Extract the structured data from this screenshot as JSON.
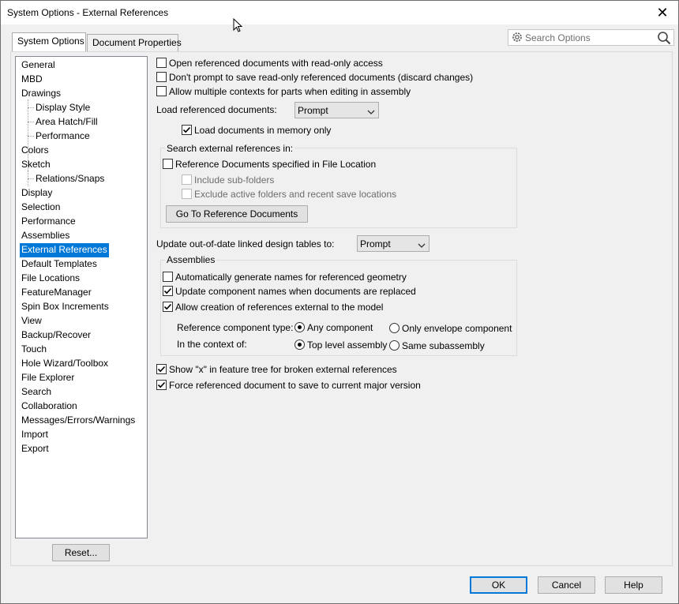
{
  "window": {
    "title": "System Options - External References"
  },
  "tabs": [
    {
      "label": "System Options",
      "active": true
    },
    {
      "label": "Document Properties",
      "active": false
    }
  ],
  "search": {
    "placeholder": "Search Options"
  },
  "tree": [
    {
      "label": "General"
    },
    {
      "label": "MBD"
    },
    {
      "label": "Drawings"
    },
    {
      "label": "Display Style",
      "child": true
    },
    {
      "label": "Area Hatch/Fill",
      "child": true
    },
    {
      "label": "Performance",
      "child": true
    },
    {
      "label": "Colors"
    },
    {
      "label": "Sketch"
    },
    {
      "label": "Relations/Snaps",
      "child": true
    },
    {
      "label": "Display"
    },
    {
      "label": "Selection"
    },
    {
      "label": "Performance"
    },
    {
      "label": "Assemblies"
    },
    {
      "label": "External References",
      "selected": true
    },
    {
      "label": "Default Templates"
    },
    {
      "label": "File Locations"
    },
    {
      "label": "FeatureManager"
    },
    {
      "label": "Spin Box Increments"
    },
    {
      "label": "View"
    },
    {
      "label": "Backup/Recover"
    },
    {
      "label": "Touch"
    },
    {
      "label": "Hole Wizard/Toolbox"
    },
    {
      "label": "File Explorer"
    },
    {
      "label": "Search"
    },
    {
      "label": "Collaboration"
    },
    {
      "label": "Messages/Errors/Warnings"
    },
    {
      "label": "Import"
    },
    {
      "label": "Export"
    }
  ],
  "reset_label": "Reset...",
  "options": {
    "open_readonly": {
      "label": "Open referenced documents with read-only access",
      "checked": false
    },
    "dont_prompt": {
      "label": "Don't prompt to save read-only referenced documents (discard changes)",
      "checked": false
    },
    "multiple_contexts": {
      "label": "Allow multiple contexts for parts when editing in assembly",
      "checked": false
    },
    "load_label": "Load referenced documents:",
    "load_value": "Prompt",
    "load_memory": {
      "label": "Load documents in memory only",
      "checked": true
    }
  },
  "search_group": {
    "title": "Search external references in:",
    "ref_docs": {
      "label": "Reference Documents specified in File Location",
      "checked": false
    },
    "subfolders": {
      "label": "Include sub-folders",
      "checked": false
    },
    "exclude_active": {
      "label": "Exclude active folders and recent save locations",
      "checked": false
    },
    "goto_button": "Go To Reference Documents"
  },
  "design_tables": {
    "label": "Update out-of-date linked design tables to:",
    "value": "Prompt"
  },
  "assemblies": {
    "title": "Assemblies",
    "auto_names": {
      "label": "Automatically generate names for referenced geometry",
      "checked": false
    },
    "update_names": {
      "label": "Update component names when documents are replaced",
      "checked": true
    },
    "allow_external": {
      "label": "Allow creation of references external to the model",
      "checked": true
    },
    "ref_type_label": "Reference component type:",
    "any_component": {
      "label": "Any component",
      "selected": true
    },
    "envelope_only": {
      "label": "Only envelope component",
      "selected": false
    },
    "context_label": "In the context of:",
    "top_level": {
      "label": "Top level assembly",
      "selected": true
    },
    "same_sub": {
      "label": "Same subassembly",
      "selected": false
    }
  },
  "show_x": {
    "label": "Show \"x\" in feature tree for broken external references",
    "checked": true
  },
  "force_save": {
    "label": "Force referenced document to save to current major version",
    "checked": true
  },
  "footer": {
    "ok": "OK",
    "cancel": "Cancel",
    "help": "Help"
  }
}
